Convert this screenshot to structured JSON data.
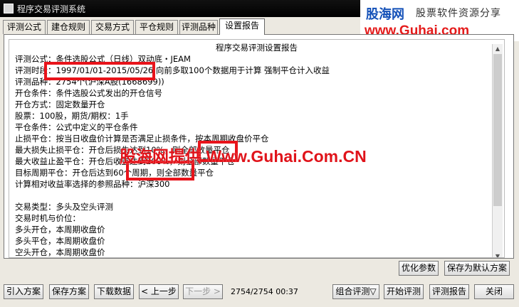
{
  "window": {
    "title": "程序交易评测系统"
  },
  "tabs": [
    "评测公式",
    "建仓规则",
    "交易方式",
    "平仓规则",
    "评测品种",
    "设置报告"
  ],
  "report": {
    "title": "程序交易评测设置报告",
    "lines": [
      "评测公式：条件选股公式（日线）双动底・JEAM",
      "评测时段：1997/01/01-2015/05/26 向前多取100个数据用于计算 强制平仓计入收益",
      "评测品种：2754个(沪深A股(1668699))",
      "开仓条件：条件选股公式发出的开仓信号",
      "开仓方式：固定数量开仓",
      "          股票：100股，期货/期权：1手",
      "平仓条件：公式中定义的平仓条件",
      "止损平仓：按当日收盘价计算是否满足止损条件，按本周期收盘价平仓",
      "          最大损失止损平仓：开仓后损失达到10%，则全部数量平仓",
      "          最大收益止盈平仓：开仓后收益达到200%，则全部数量平仓",
      "          目标周期平仓：开仓后达到60个周期，则全部数量平仓",
      "          计算相对收益率选择的参照品种：沪深300",
      "",
      "交易类型：多头及空头评测",
      "交易时机与价位：",
      "          多头开仓，本周期收盘价",
      "          多头平仓，本周期收盘价",
      "          空头开仓，本周期收盘价"
    ]
  },
  "buttons": {
    "optimize": "优化参数",
    "save_default": "保存为默认方案",
    "import": "引入方案",
    "save": "保存方案",
    "download": "下载数据",
    "prev": "< 上一步",
    "next": "下一步 >",
    "combo": "组合评测▽",
    "start": "开始评测",
    "report": "评测报告",
    "close": "关闭"
  },
  "status": "2754/2754 00:37",
  "watermark": "股海网提供 Www.Guhai.Com.CN",
  "logo": {
    "name": "股海网",
    "tagline": "股票软件资源分享",
    "url": "www.Guhai.com"
  },
  "colors": {
    "accent": "#e41b1b",
    "brand": "#1451b8"
  },
  "icons": {
    "titlebar": "app-icon",
    "scroll_up": "scroll-up-icon",
    "scroll_down": "scroll-down-icon"
  }
}
